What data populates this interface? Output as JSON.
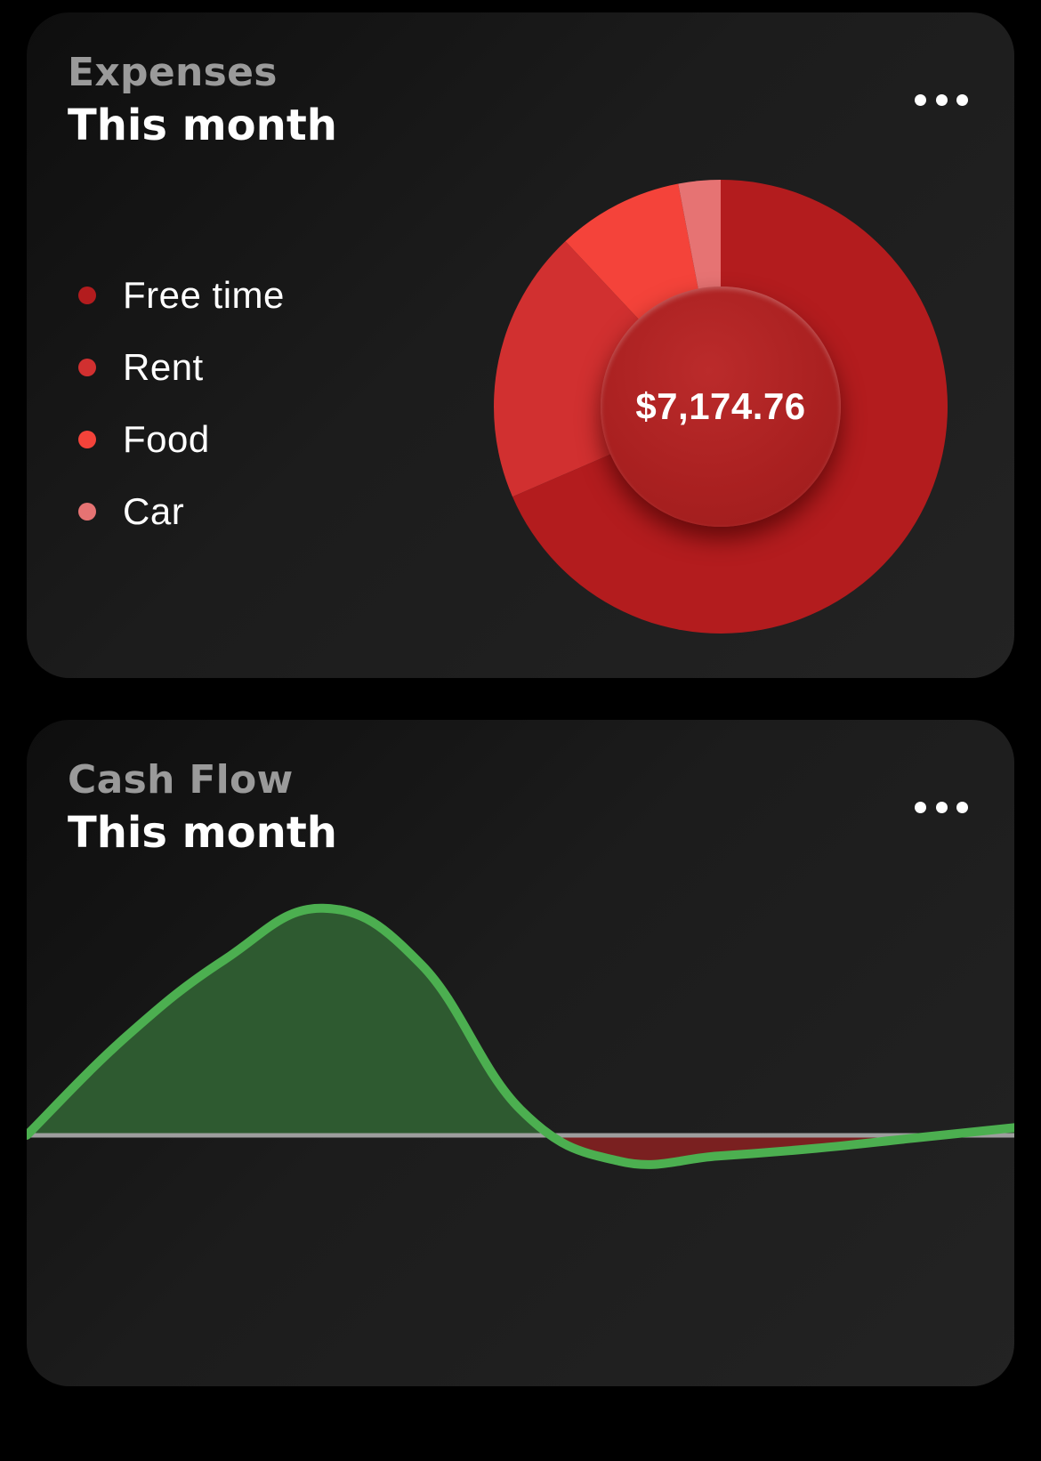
{
  "expenses_card": {
    "title": "Expenses",
    "subtitle": "This month",
    "more_icon": "ellipsis-icon",
    "total": "$7,174.76"
  },
  "cashflow_card": {
    "title": "Cash Flow",
    "subtitle": "This month",
    "more_icon": "ellipsis-icon"
  },
  "chart_data": [
    {
      "type": "pie",
      "variant": "donut",
      "categories": [
        "Free time",
        "Rent",
        "Food",
        "Car"
      ],
      "values": [
        68.5,
        19.5,
        9.0,
        3.0
      ],
      "colors": [
        "#b31c1e",
        "#d13030",
        "#f4433a",
        "#e67373"
      ],
      "center_label": "$7,174.76",
      "legend": "left"
    },
    {
      "type": "area",
      "x": [
        0,
        1,
        2,
        3,
        4,
        5,
        6,
        7,
        8,
        9,
        10
      ],
      "values": [
        0,
        1.9,
        3.4,
        4.4,
        3.3,
        0.5,
        -0.5,
        -0.4,
        -0.25,
        -0.05,
        0.15
      ],
      "positive_color": "#4caf50",
      "negative_color": "#7a2020",
      "baseline": 0,
      "grid": false
    }
  ]
}
